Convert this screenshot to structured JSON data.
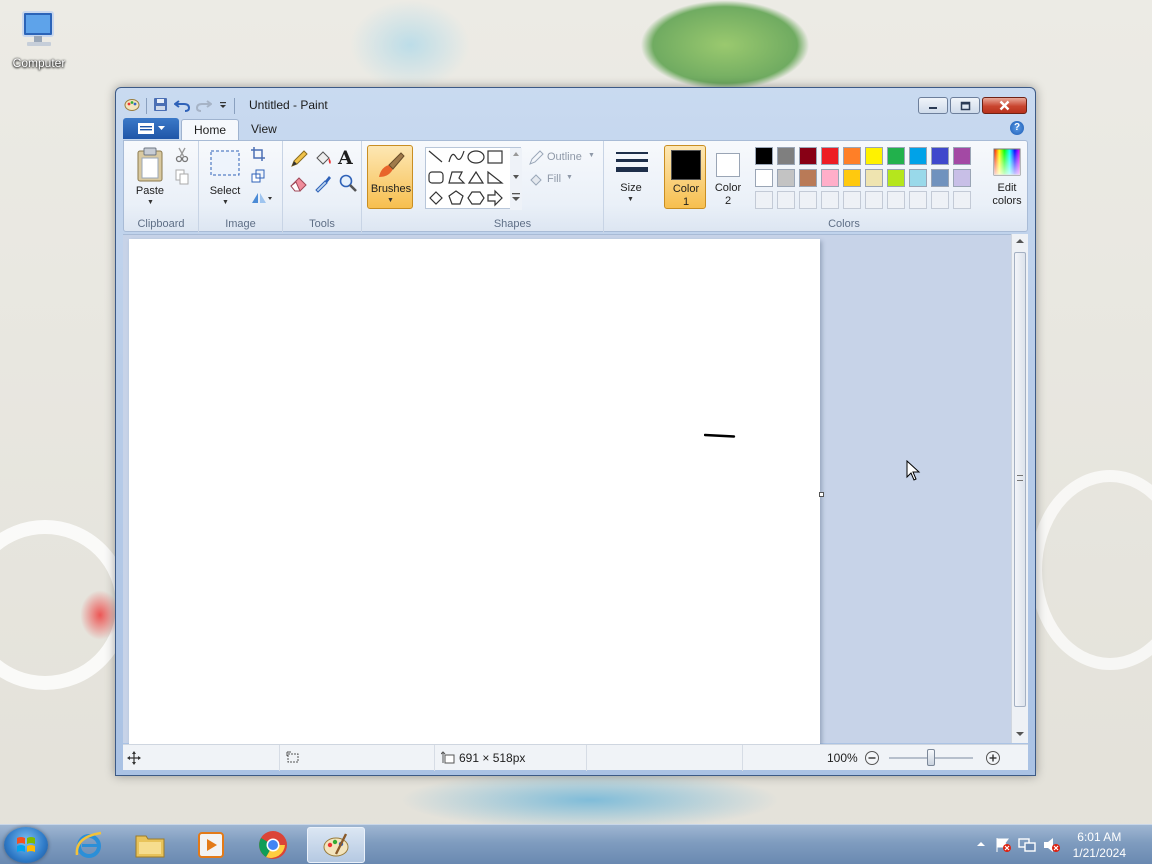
{
  "desktop": {
    "icon_label": "Computer"
  },
  "window": {
    "title": "Untitled - Paint",
    "tabs": [
      {
        "label": "Home"
      },
      {
        "label": "View"
      }
    ]
  },
  "ribbon": {
    "clipboard": {
      "group_label": "Clipboard",
      "paste_label": "Paste"
    },
    "image": {
      "group_label": "Image",
      "select_label": "Select"
    },
    "tools": {
      "group_label": "Tools"
    },
    "brushes": {
      "label": "Brushes"
    },
    "shapes": {
      "group_label": "Shapes",
      "outline_label": "Outline",
      "fill_label": "Fill"
    },
    "size": {
      "label": "Size"
    },
    "colors": {
      "group_label": "Colors",
      "color1_label_line1": "Color",
      "color1_label_line2": "1",
      "color2_label_line1": "Color",
      "color2_label_line2": "2",
      "edit_label_line1": "Edit",
      "edit_label_line2": "colors",
      "color1": "#000000",
      "color2": "#ffffff",
      "palette_row1": [
        "#000000",
        "#7f7f7f",
        "#880015",
        "#ed1c24",
        "#ff7f27",
        "#fff200",
        "#22b14c",
        "#00a2e8",
        "#3f48cc",
        "#a349a4"
      ],
      "palette_row2": [
        "#ffffff",
        "#c3c3c3",
        "#b97a57",
        "#ffaec9",
        "#ffc90e",
        "#efe4b0",
        "#b5e61d",
        "#99d9ea",
        "#7092be",
        "#c8bfe7"
      ]
    }
  },
  "status": {
    "dimensions": "691 × 518px",
    "zoom": "100%"
  },
  "taskbar": {
    "time": "6:01 AM",
    "date": "1/21/2024"
  }
}
